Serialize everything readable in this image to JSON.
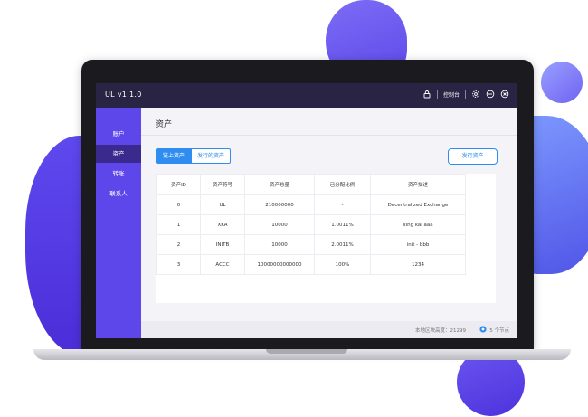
{
  "app": {
    "title": "UL  v1.1.0"
  },
  "titlebar": {
    "console_label": "控制台"
  },
  "sidebar": {
    "items": [
      {
        "label": "账户"
      },
      {
        "label": "资产"
      },
      {
        "label": "转账"
      },
      {
        "label": "联系人"
      }
    ],
    "active_index": 1
  },
  "main": {
    "title": "资产",
    "tabs": [
      {
        "label": "链上资产"
      },
      {
        "label": "发行的资产"
      }
    ],
    "issue_button": "发行资产"
  },
  "table": {
    "headers": [
      "资产ID",
      "资产符号",
      "资产总量",
      "已分配比例",
      "资产描述"
    ],
    "rows": [
      [
        "0",
        "UL",
        "210000000",
        "-",
        "Decentralized Exchange"
      ],
      [
        "1",
        "XKA",
        "10000",
        "1.0011%",
        "xing kai aaa"
      ],
      [
        "2",
        "INITB",
        "10000",
        "2.0011%",
        "init - bbb"
      ],
      [
        "3",
        "ACCC",
        "10000000000000",
        "100%",
        "1234"
      ]
    ]
  },
  "status": {
    "block_height": "本地区块高度：21299",
    "nodes": "5 个节点"
  },
  "colors": {
    "accent": "#2f8cf0",
    "sidebar": "#5d47ea",
    "titlebar": "#2a2444"
  }
}
